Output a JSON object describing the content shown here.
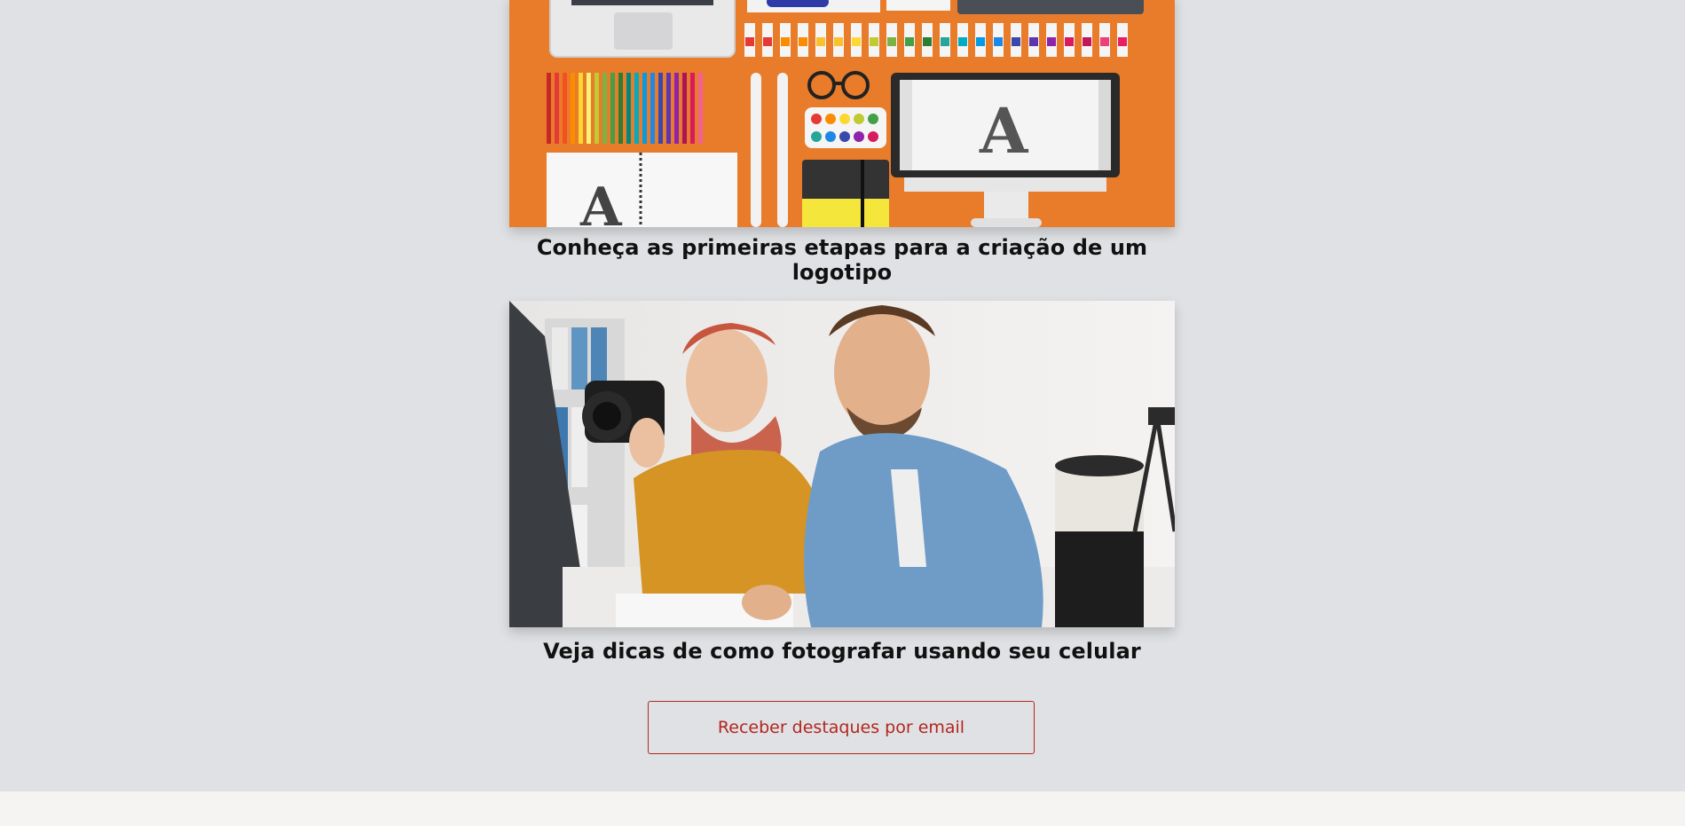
{
  "articles": [
    {
      "title": "Conheça as primeiras etapas para a criação de um logotipo",
      "image_alt": "Flat lay of design tools on orange background: laptop, paint tubes, colored pencils, glasses, watercolor palette, notebooks and a monitor showing the letter A"
    },
    {
      "title": "Veja dicas de como fotografar usando seu celular",
      "image_alt": "Woman holding a camera showing a man, both leaning over a desk in a studio"
    }
  ],
  "subscribe": {
    "label": "Receber destaques por email"
  },
  "colors": {
    "page_background": "#dfe1e4",
    "footer_background": "#f5f4f2",
    "accent": "#b3261e",
    "illustration_orange": "#e87c2a"
  }
}
